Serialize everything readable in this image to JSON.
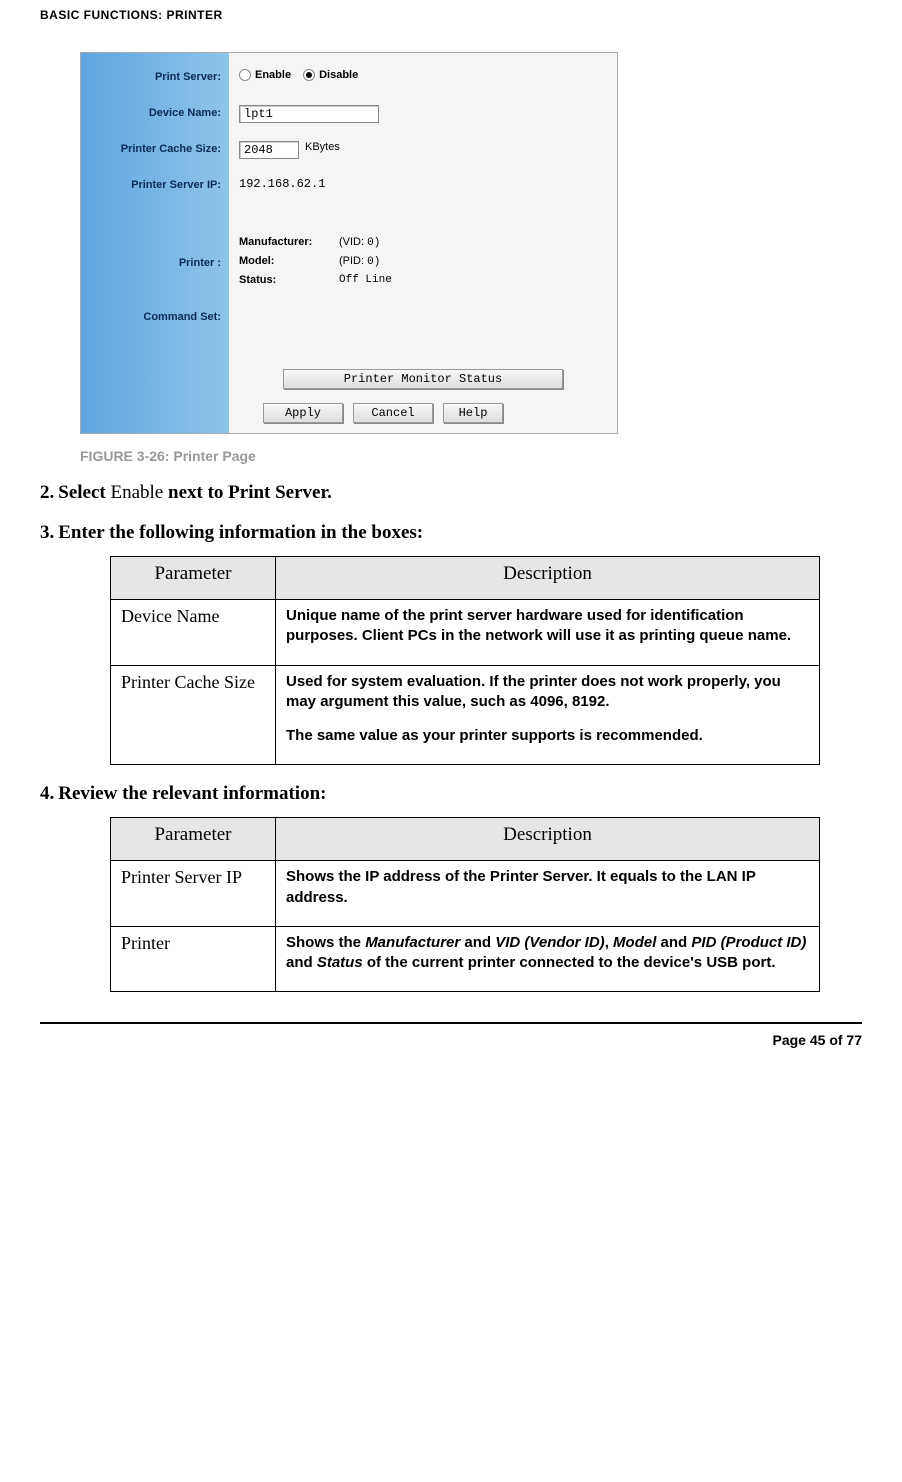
{
  "header": {
    "section": "BASIC FUNCTIONS: PRINTER"
  },
  "router": {
    "labels": {
      "print_server": "Print Server:",
      "device_name": "Device Name:",
      "cache": "Printer Cache Size:",
      "server_ip": "Printer Server IP:",
      "printer": "Printer :",
      "cmdset": "Command Set:"
    },
    "enable": "Enable",
    "disable": "Disable",
    "device_value": "lpt1",
    "cache_value": "2048",
    "cache_unit": "KBytes",
    "server_ip_value": "192.168.62.1",
    "printer_info": {
      "manufacturer": "Manufacturer:",
      "vid_lbl": "(VID:",
      "vid_val": "0)",
      "model": "Model:",
      "pid_lbl": "(PID:",
      "pid_val": "0)",
      "status_lbl": "Status:",
      "status_val": "Off Line"
    },
    "buttons": {
      "monitor": "Printer Monitor Status",
      "apply": "Apply",
      "cancel": "Cancel",
      "help": "Help"
    }
  },
  "figure_caption": "FIGURE 3-26: Printer Page",
  "steps": {
    "s2": {
      "num": "2.",
      "bold1": "Select ",
      "nb": "Enable ",
      "bold2": "next to Print Server."
    },
    "s3": {
      "num": "3.",
      "text": "Enter the following information in the boxes:"
    },
    "s4": {
      "num": "4.",
      "text": "Review the relevant information:"
    }
  },
  "table_headers": {
    "param": "Parameter",
    "desc": "Description"
  },
  "table1": [
    {
      "param": "Device Name",
      "desc": "Unique name of the print server hardware used for identification purposes. Client PCs in the network will use it as printing queue name."
    },
    {
      "param": "Printer Cache Size",
      "desc_p1": "Used for system evaluation. If the printer does not work properly, you may argument this value, such as 4096, 8192.",
      "desc_p2": "The same value as your printer supports is recommended."
    }
  ],
  "table2": [
    {
      "param": "Printer Server IP",
      "desc": "Shows the IP address of the Printer Server. It equals to the LAN IP address."
    },
    {
      "param": "Printer",
      "desc_pre": "Shows the ",
      "d_manu": "Manufacturer",
      "d_and1": " and ",
      "d_vid": "VID (Vendor ID)",
      "d_comma": ", ",
      "d_model": "Model",
      "d_and2": " and ",
      "d_pid": "PID (Product ID)",
      "d_and3": " and ",
      "d_status": "Status",
      "desc_post": " of the current printer connected to the device's USB port."
    }
  ],
  "footer": {
    "page": "Page 45 of 77"
  }
}
